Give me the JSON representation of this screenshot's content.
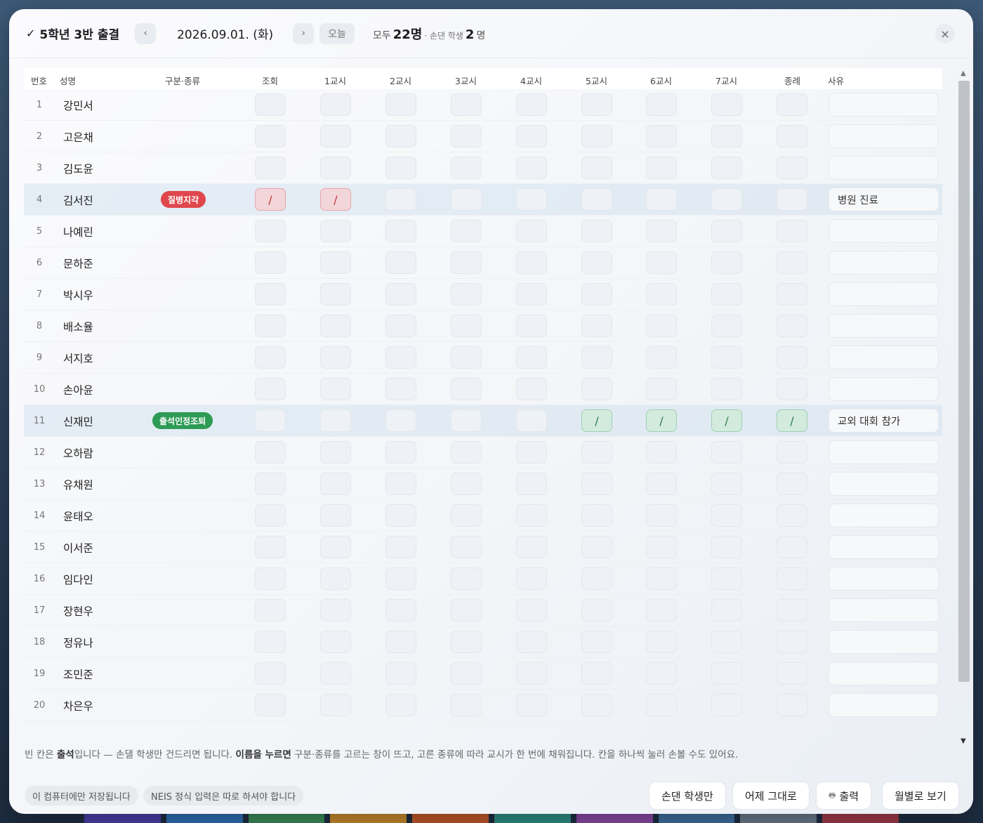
{
  "header": {
    "title": "5학년 3반 출결",
    "prev": "‹",
    "date": "2026.09.01. (화)",
    "next": "›",
    "today": "오늘",
    "total_label": "모두",
    "total_count": "22명",
    "separator": "· 손댄 학생",
    "touched_count": "2",
    "touched_unit": "명",
    "close": "×"
  },
  "columns": {
    "num": "번호",
    "name": "성명",
    "category": "구분·종류",
    "periods": [
      "조회",
      "1교시",
      "2교시",
      "3교시",
      "4교시",
      "5교시",
      "6교시",
      "7교시",
      "종례"
    ],
    "reason": "사유"
  },
  "students": [
    {
      "num": "1",
      "name": "강민서",
      "badge": "",
      "badge_color": "",
      "marks": [],
      "mark_color": "",
      "reason": ""
    },
    {
      "num": "2",
      "name": "고은채",
      "badge": "",
      "badge_color": "",
      "marks": [],
      "mark_color": "",
      "reason": ""
    },
    {
      "num": "3",
      "name": "김도윤",
      "badge": "",
      "badge_color": "",
      "marks": [],
      "mark_color": "",
      "reason": ""
    },
    {
      "num": "4",
      "name": "김서진",
      "badge": "질병지각",
      "badge_color": "red",
      "marks": [
        0,
        1
      ],
      "mark_color": "red",
      "reason": "병원 진료"
    },
    {
      "num": "5",
      "name": "나예린",
      "badge": "",
      "badge_color": "",
      "marks": [],
      "mark_color": "",
      "reason": ""
    },
    {
      "num": "6",
      "name": "문하준",
      "badge": "",
      "badge_color": "",
      "marks": [],
      "mark_color": "",
      "reason": ""
    },
    {
      "num": "7",
      "name": "박시우",
      "badge": "",
      "badge_color": "",
      "marks": [],
      "mark_color": "",
      "reason": ""
    },
    {
      "num": "8",
      "name": "배소율",
      "badge": "",
      "badge_color": "",
      "marks": [],
      "mark_color": "",
      "reason": ""
    },
    {
      "num": "9",
      "name": "서지호",
      "badge": "",
      "badge_color": "",
      "marks": [],
      "mark_color": "",
      "reason": ""
    },
    {
      "num": "10",
      "name": "손아윤",
      "badge": "",
      "badge_color": "",
      "marks": [],
      "mark_color": "",
      "reason": ""
    },
    {
      "num": "11",
      "name": "신재민",
      "badge": "출석인정조퇴",
      "badge_color": "green",
      "marks": [
        5,
        6,
        7,
        8
      ],
      "mark_color": "green",
      "reason": "교외 대회 참가"
    },
    {
      "num": "12",
      "name": "오하람",
      "badge": "",
      "badge_color": "",
      "marks": [],
      "mark_color": "",
      "reason": ""
    },
    {
      "num": "13",
      "name": "유채원",
      "badge": "",
      "badge_color": "",
      "marks": [],
      "mark_color": "",
      "reason": ""
    },
    {
      "num": "14",
      "name": "윤태오",
      "badge": "",
      "badge_color": "",
      "marks": [],
      "mark_color": "",
      "reason": ""
    },
    {
      "num": "15",
      "name": "이서준",
      "badge": "",
      "badge_color": "",
      "marks": [],
      "mark_color": "",
      "reason": ""
    },
    {
      "num": "16",
      "name": "임다인",
      "badge": "",
      "badge_color": "",
      "marks": [],
      "mark_color": "",
      "reason": ""
    },
    {
      "num": "17",
      "name": "장현우",
      "badge": "",
      "badge_color": "",
      "marks": [],
      "mark_color": "",
      "reason": ""
    },
    {
      "num": "18",
      "name": "정유나",
      "badge": "",
      "badge_color": "",
      "marks": [],
      "mark_color": "",
      "reason": ""
    },
    {
      "num": "19",
      "name": "조민준",
      "badge": "",
      "badge_color": "",
      "marks": [],
      "mark_color": "",
      "reason": ""
    },
    {
      "num": "20",
      "name": "차은우",
      "badge": "",
      "badge_color": "",
      "marks": [],
      "mark_color": "",
      "reason": ""
    }
  ],
  "mark_symbol": "/",
  "hint": {
    "p1": "빈 칸은 ",
    "b1": "출석",
    "p2": "입니다 — 손댈 학생만 건드리면 됩니다. ",
    "b2": "이름을 누르면",
    "p3": " 구분·종류를 고르는 창이 뜨고, 고른 종류에 따라 교시가 한 번에 채워집니다. 칸을 하나씩 눌러 손볼 수도 있어요."
  },
  "footer": {
    "chip_local": "이 컴퓨터에만 저장됩니다",
    "chip_neis": "NEIS 정식 입력은 따로 하셔야 합니다",
    "btn_touched": "손댄 학생만",
    "btn_yesterday": "어제 그대로",
    "btn_print": "출력",
    "btn_monthly": "월별로 보기"
  },
  "colors": {
    "accent_red": "#e0474d",
    "accent_green": "#2d9b55"
  }
}
